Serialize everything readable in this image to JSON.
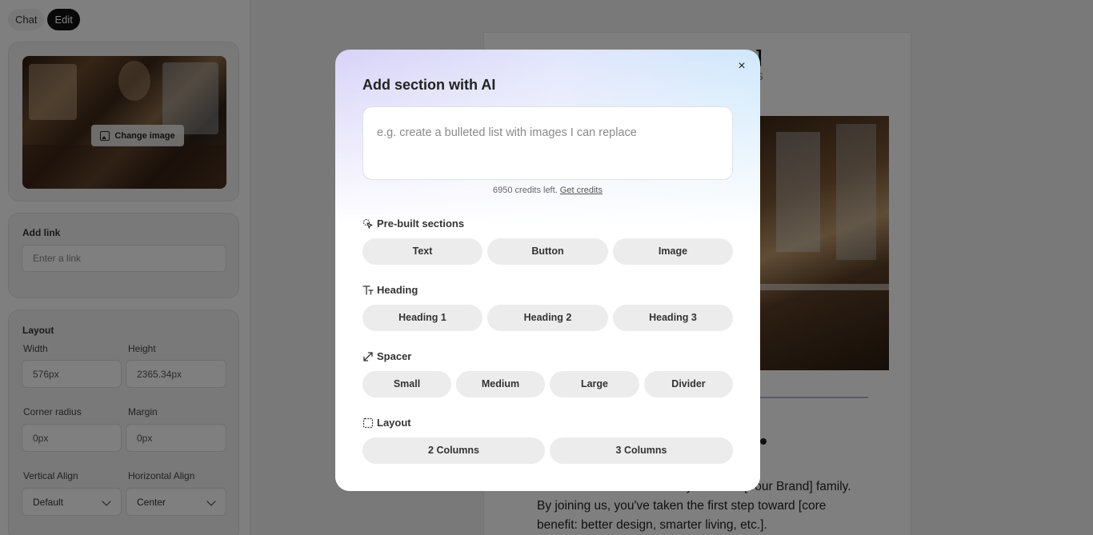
{
  "mode_switch": {
    "chat": "Chat",
    "edit": "Edit"
  },
  "image_card": {
    "change_image_label": "Change image"
  },
  "link_card": {
    "title": "Add link",
    "placeholder": "Enter a link"
  },
  "layout_card": {
    "title": "Layout",
    "width_label": "Width",
    "width_value": "576px",
    "height_label": "Height",
    "height_value": "2365.34px",
    "corner_radius_label": "Corner radius",
    "corner_radius_value": "0px",
    "margin_label": "Margin",
    "margin_value": "0px",
    "vertical_align_label": "Vertical Align",
    "vertical_align_value": "Default",
    "horizontal_align_label": "Horizontal Align",
    "horizontal_align_value": "Center"
  },
  "canvas": {
    "title_fragment": "]",
    "subtitle_fragment": "S",
    "heading_fragment": ".",
    "paragraph_lines": [
      "We are thrilled to welcome you to the [Your Brand] family.",
      "By joining us, you've taken the first step toward [core",
      "benefit: better design, smarter living, etc.]."
    ]
  },
  "modal": {
    "title": "Add section with AI",
    "close_label": "×",
    "prompt_placeholder": "e.g. create a bulleted list with images I can replace",
    "credits_text": "6950 credits left.",
    "credits_link": "Get credits",
    "sections": {
      "prebuilt": {
        "title": "Pre-built sections",
        "items": [
          "Text",
          "Button",
          "Image"
        ]
      },
      "heading": {
        "title": "Heading",
        "items": [
          "Heading 1",
          "Heading 2",
          "Heading 3"
        ]
      },
      "spacer": {
        "title": "Spacer",
        "items": [
          "Small",
          "Medium",
          "Large",
          "Divider"
        ]
      },
      "layout": {
        "title": "Layout",
        "items": [
          "2 Columns",
          "3 Columns"
        ]
      }
    }
  },
  "colors": {
    "overlay": "#000000",
    "modal_gradient_left": "#d8d2f8",
    "modal_gradient_right": "#c9e9fb",
    "chip_bg": "#ececec",
    "edit_active": "#111111"
  }
}
